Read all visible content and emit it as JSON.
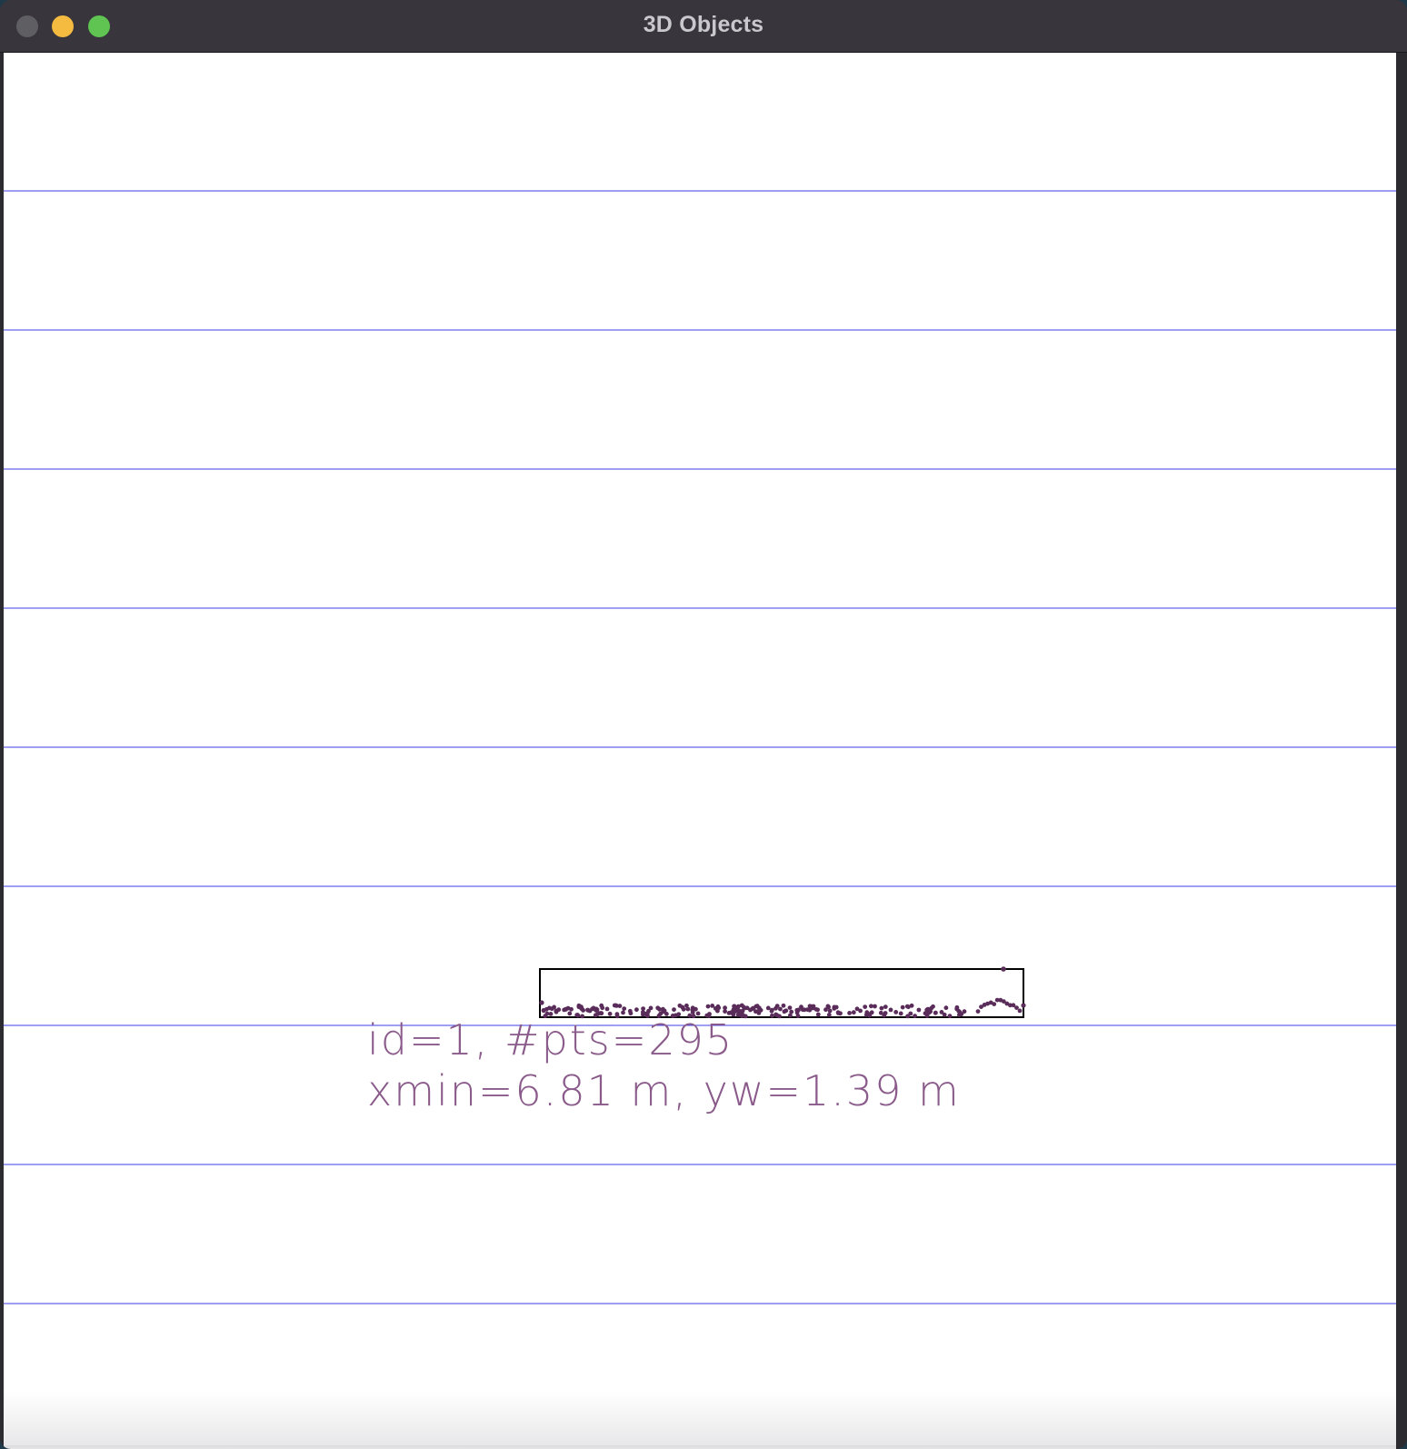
{
  "window": {
    "title": "3D Objects",
    "traffic_lights": {
      "close_color": "#5f5e63",
      "minimize_color": "#f4bb40",
      "zoom_color": "#5fc452"
    }
  },
  "canvas": {
    "background": "#ffffff",
    "grid_line_color": "#3c3ce6",
    "grid_line_count": 9,
    "object": {
      "box_color": "#000000",
      "point_color": "#5a2c5a",
      "label_color": "#8a5a8a",
      "label_line_1": "id=1,  #pts=295",
      "label_line_2": "xmin=6.81  m,  yw=1.39  m"
    }
  }
}
